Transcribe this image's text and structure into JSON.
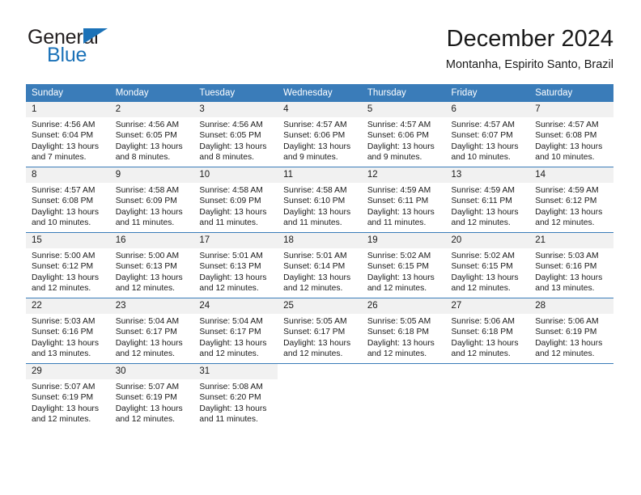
{
  "brand": {
    "name_top": "General",
    "name_bottom": "Blue",
    "triangle_color": "#1b72b8"
  },
  "header": {
    "title": "December 2024",
    "subtitle": "Montanha, Espirito Santo, Brazil"
  },
  "theme": {
    "header_bg": "#3a7cb9",
    "daynum_bg": "#f1f1f1",
    "separator": "#3a7cb9",
    "text": "#1a1a1a"
  },
  "weekdays": [
    "Sunday",
    "Monday",
    "Tuesday",
    "Wednesday",
    "Thursday",
    "Friday",
    "Saturday"
  ],
  "weeks": [
    [
      {
        "day": "1",
        "sunrise": "Sunrise: 4:56 AM",
        "sunset": "Sunset: 6:04 PM",
        "daylight1": "Daylight: 13 hours",
        "daylight2": "and 7 minutes."
      },
      {
        "day": "2",
        "sunrise": "Sunrise: 4:56 AM",
        "sunset": "Sunset: 6:05 PM",
        "daylight1": "Daylight: 13 hours",
        "daylight2": "and 8 minutes."
      },
      {
        "day": "3",
        "sunrise": "Sunrise: 4:56 AM",
        "sunset": "Sunset: 6:05 PM",
        "daylight1": "Daylight: 13 hours",
        "daylight2": "and 8 minutes."
      },
      {
        "day": "4",
        "sunrise": "Sunrise: 4:57 AM",
        "sunset": "Sunset: 6:06 PM",
        "daylight1": "Daylight: 13 hours",
        "daylight2": "and 9 minutes."
      },
      {
        "day": "5",
        "sunrise": "Sunrise: 4:57 AM",
        "sunset": "Sunset: 6:06 PM",
        "daylight1": "Daylight: 13 hours",
        "daylight2": "and 9 minutes."
      },
      {
        "day": "6",
        "sunrise": "Sunrise: 4:57 AM",
        "sunset": "Sunset: 6:07 PM",
        "daylight1": "Daylight: 13 hours",
        "daylight2": "and 10 minutes."
      },
      {
        "day": "7",
        "sunrise": "Sunrise: 4:57 AM",
        "sunset": "Sunset: 6:08 PM",
        "daylight1": "Daylight: 13 hours",
        "daylight2": "and 10 minutes."
      }
    ],
    [
      {
        "day": "8",
        "sunrise": "Sunrise: 4:57 AM",
        "sunset": "Sunset: 6:08 PM",
        "daylight1": "Daylight: 13 hours",
        "daylight2": "and 10 minutes."
      },
      {
        "day": "9",
        "sunrise": "Sunrise: 4:58 AM",
        "sunset": "Sunset: 6:09 PM",
        "daylight1": "Daylight: 13 hours",
        "daylight2": "and 11 minutes."
      },
      {
        "day": "10",
        "sunrise": "Sunrise: 4:58 AM",
        "sunset": "Sunset: 6:09 PM",
        "daylight1": "Daylight: 13 hours",
        "daylight2": "and 11 minutes."
      },
      {
        "day": "11",
        "sunrise": "Sunrise: 4:58 AM",
        "sunset": "Sunset: 6:10 PM",
        "daylight1": "Daylight: 13 hours",
        "daylight2": "and 11 minutes."
      },
      {
        "day": "12",
        "sunrise": "Sunrise: 4:59 AM",
        "sunset": "Sunset: 6:11 PM",
        "daylight1": "Daylight: 13 hours",
        "daylight2": "and 11 minutes."
      },
      {
        "day": "13",
        "sunrise": "Sunrise: 4:59 AM",
        "sunset": "Sunset: 6:11 PM",
        "daylight1": "Daylight: 13 hours",
        "daylight2": "and 12 minutes."
      },
      {
        "day": "14",
        "sunrise": "Sunrise: 4:59 AM",
        "sunset": "Sunset: 6:12 PM",
        "daylight1": "Daylight: 13 hours",
        "daylight2": "and 12 minutes."
      }
    ],
    [
      {
        "day": "15",
        "sunrise": "Sunrise: 5:00 AM",
        "sunset": "Sunset: 6:12 PM",
        "daylight1": "Daylight: 13 hours",
        "daylight2": "and 12 minutes."
      },
      {
        "day": "16",
        "sunrise": "Sunrise: 5:00 AM",
        "sunset": "Sunset: 6:13 PM",
        "daylight1": "Daylight: 13 hours",
        "daylight2": "and 12 minutes."
      },
      {
        "day": "17",
        "sunrise": "Sunrise: 5:01 AM",
        "sunset": "Sunset: 6:13 PM",
        "daylight1": "Daylight: 13 hours",
        "daylight2": "and 12 minutes."
      },
      {
        "day": "18",
        "sunrise": "Sunrise: 5:01 AM",
        "sunset": "Sunset: 6:14 PM",
        "daylight1": "Daylight: 13 hours",
        "daylight2": "and 12 minutes."
      },
      {
        "day": "19",
        "sunrise": "Sunrise: 5:02 AM",
        "sunset": "Sunset: 6:15 PM",
        "daylight1": "Daylight: 13 hours",
        "daylight2": "and 12 minutes."
      },
      {
        "day": "20",
        "sunrise": "Sunrise: 5:02 AM",
        "sunset": "Sunset: 6:15 PM",
        "daylight1": "Daylight: 13 hours",
        "daylight2": "and 12 minutes."
      },
      {
        "day": "21",
        "sunrise": "Sunrise: 5:03 AM",
        "sunset": "Sunset: 6:16 PM",
        "daylight1": "Daylight: 13 hours",
        "daylight2": "and 13 minutes."
      }
    ],
    [
      {
        "day": "22",
        "sunrise": "Sunrise: 5:03 AM",
        "sunset": "Sunset: 6:16 PM",
        "daylight1": "Daylight: 13 hours",
        "daylight2": "and 13 minutes."
      },
      {
        "day": "23",
        "sunrise": "Sunrise: 5:04 AM",
        "sunset": "Sunset: 6:17 PM",
        "daylight1": "Daylight: 13 hours",
        "daylight2": "and 12 minutes."
      },
      {
        "day": "24",
        "sunrise": "Sunrise: 5:04 AM",
        "sunset": "Sunset: 6:17 PM",
        "daylight1": "Daylight: 13 hours",
        "daylight2": "and 12 minutes."
      },
      {
        "day": "25",
        "sunrise": "Sunrise: 5:05 AM",
        "sunset": "Sunset: 6:17 PM",
        "daylight1": "Daylight: 13 hours",
        "daylight2": "and 12 minutes."
      },
      {
        "day": "26",
        "sunrise": "Sunrise: 5:05 AM",
        "sunset": "Sunset: 6:18 PM",
        "daylight1": "Daylight: 13 hours",
        "daylight2": "and 12 minutes."
      },
      {
        "day": "27",
        "sunrise": "Sunrise: 5:06 AM",
        "sunset": "Sunset: 6:18 PM",
        "daylight1": "Daylight: 13 hours",
        "daylight2": "and 12 minutes."
      },
      {
        "day": "28",
        "sunrise": "Sunrise: 5:06 AM",
        "sunset": "Sunset: 6:19 PM",
        "daylight1": "Daylight: 13 hours",
        "daylight2": "and 12 minutes."
      }
    ],
    [
      {
        "day": "29",
        "sunrise": "Sunrise: 5:07 AM",
        "sunset": "Sunset: 6:19 PM",
        "daylight1": "Daylight: 13 hours",
        "daylight2": "and 12 minutes."
      },
      {
        "day": "30",
        "sunrise": "Sunrise: 5:07 AM",
        "sunset": "Sunset: 6:19 PM",
        "daylight1": "Daylight: 13 hours",
        "daylight2": "and 12 minutes."
      },
      {
        "day": "31",
        "sunrise": "Sunrise: 5:08 AM",
        "sunset": "Sunset: 6:20 PM",
        "daylight1": "Daylight: 13 hours",
        "daylight2": "and 11 minutes."
      },
      {
        "day": "",
        "sunrise": "",
        "sunset": "",
        "daylight1": "",
        "daylight2": ""
      },
      {
        "day": "",
        "sunrise": "",
        "sunset": "",
        "daylight1": "",
        "daylight2": ""
      },
      {
        "day": "",
        "sunrise": "",
        "sunset": "",
        "daylight1": "",
        "daylight2": ""
      },
      {
        "day": "",
        "sunrise": "",
        "sunset": "",
        "daylight1": "",
        "daylight2": ""
      }
    ]
  ]
}
